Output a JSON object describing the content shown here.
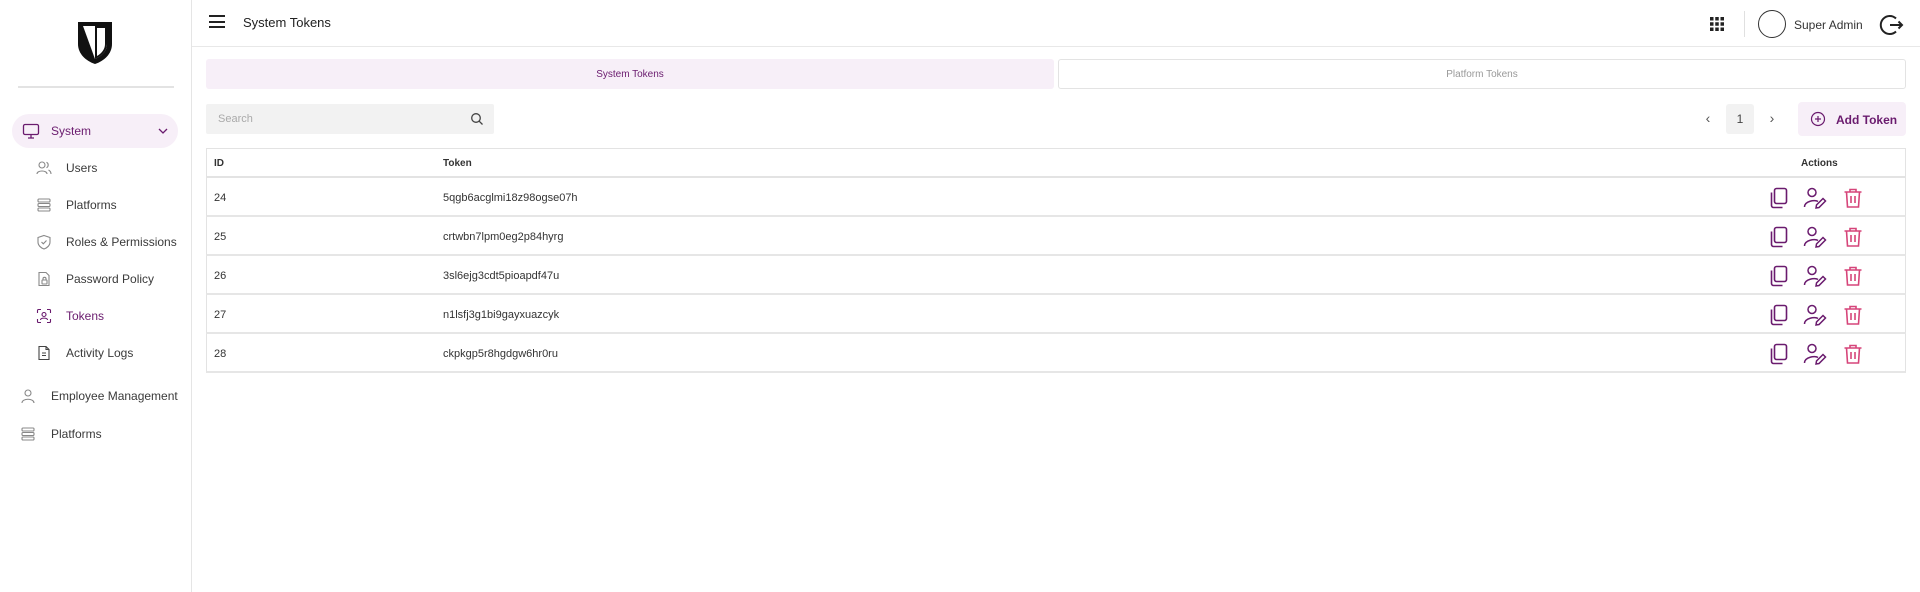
{
  "app": {
    "icons": {
      "logo": "shield-logo-icon",
      "menu": "hamburger-icon",
      "apps": "grid-icon",
      "logout": "logout-icon"
    },
    "colors": {
      "accent": "#6a1b6e",
      "accent_bg": "#f7eff8",
      "danger": "#d6457a"
    }
  },
  "sidebar": {
    "parent": {
      "label": "System",
      "icon": "monitor-icon",
      "expanded": true
    },
    "sub_items": [
      {
        "label": "Users",
        "icon": "users-icon",
        "active": false
      },
      {
        "label": "Platforms",
        "icon": "layers-icon",
        "active": false
      },
      {
        "label": "Roles & Permissions",
        "icon": "shield-check-icon",
        "active": false
      },
      {
        "label": "Password Policy",
        "icon": "document-lock-icon",
        "active": false
      },
      {
        "label": "Tokens",
        "icon": "token-scan-icon",
        "active": true
      },
      {
        "label": "Activity Logs",
        "icon": "document-list-icon",
        "active": false
      }
    ],
    "top_items": [
      {
        "label": "Employee Management",
        "icon": "person-icon"
      },
      {
        "label": "Platforms",
        "icon": "layers-icon"
      }
    ]
  },
  "header": {
    "title": "System Tokens",
    "user_name": "Super Admin"
  },
  "tabs": [
    {
      "label": "System Tokens",
      "active": true
    },
    {
      "label": "Platform Tokens",
      "active": false
    }
  ],
  "toolbar": {
    "search_placeholder": "Search",
    "search_value": "",
    "page_prev": "‹",
    "page_current": "1",
    "page_next": "›",
    "add_label": "Add Token"
  },
  "table": {
    "headers": {
      "id": "ID",
      "token": "Token",
      "actions": "Actions"
    },
    "rows": [
      {
        "id": "24",
        "token": "5qgb6acglmi18z98ogse07h"
      },
      {
        "id": "25",
        "token": "crtwbn7lpm0eg2p84hyrg"
      },
      {
        "id": "26",
        "token": "3sl6ejg3cdt5pioapdf47u"
      },
      {
        "id": "27",
        "token": "n1lsfj3g1bi9gayxuazcyk"
      },
      {
        "id": "28",
        "token": "ckpkgp5r8hgdgw6hr0ru"
      }
    ],
    "row_actions": [
      "copy-icon",
      "user-edit-icon",
      "trash-icon"
    ]
  }
}
